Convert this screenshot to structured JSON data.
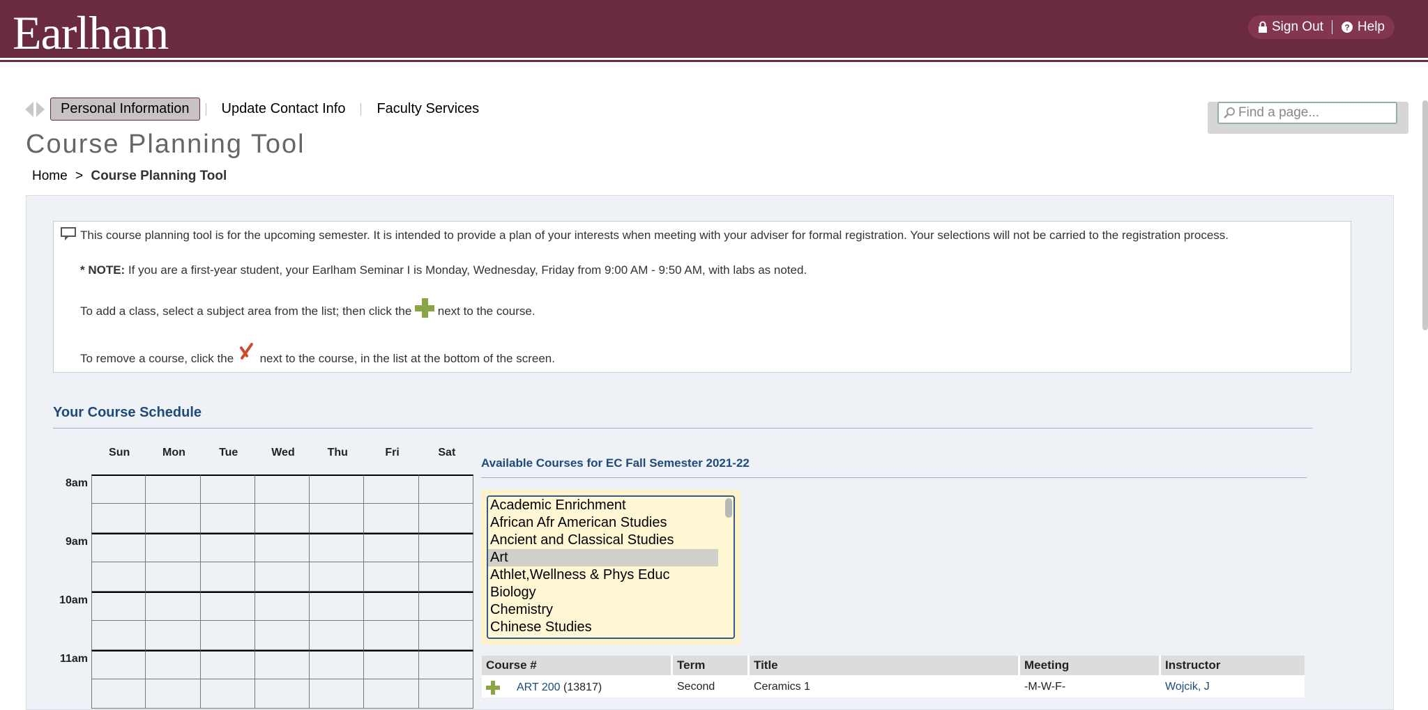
{
  "header": {
    "logo_text": "Earlham",
    "sign_out": "Sign Out",
    "help": "Help"
  },
  "nav": {
    "tabs": [
      {
        "label": "Personal Information",
        "active": true
      },
      {
        "label": "Update Contact Info",
        "active": false
      },
      {
        "label": "Faculty Services",
        "active": false
      }
    ]
  },
  "search": {
    "placeholder": "Find a page..."
  },
  "page": {
    "title": "Course Planning Tool",
    "breadcrumb_home": "Home",
    "breadcrumb_sep": ">",
    "breadcrumb_current": "Course Planning Tool"
  },
  "info": {
    "intro": "This course planning tool is for the upcoming semester. It is intended to provide a plan of your interests when meeting with your adviser for formal registration. Your selections will not be carried to the registration process.",
    "note_label": "* NOTE:",
    "note_text": " If you are a first-year student, your Earlham Seminar I is Monday, Wednesday, Friday from 9:00 AM - 9:50 AM, with labs as noted.",
    "add_before": "To add a class, select a subject area from the list; then click the ",
    "add_after": " next to the course.",
    "remove_before": "To remove a course, click the ",
    "remove_after": " next to the course, in the list at the bottom of the screen."
  },
  "schedule": {
    "title": "Your Course Schedule",
    "days": [
      "Sun",
      "Mon",
      "Tue",
      "Wed",
      "Thu",
      "Fri",
      "Sat"
    ],
    "times": [
      "8am",
      "9am",
      "10am",
      "11am"
    ]
  },
  "available": {
    "title": "Available Courses for EC Fall Semester 2021-22",
    "subjects": [
      "Academic Enrichment",
      "African Afr American Studies",
      "Ancient and Classical Studies",
      "Art",
      "Athlet,Wellness & Phys Educ",
      "Biology",
      "Chemistry",
      "Chinese Studies"
    ],
    "selected_subject": "Art"
  },
  "courses": {
    "columns": [
      "Course #",
      "Term",
      "Title",
      "Meeting",
      "Instructor"
    ],
    "rows": [
      {
        "course_link": "ART 200",
        "course_id": "(13817)",
        "term": "Second",
        "title": "Ceramics 1",
        "meeting": "-M-W-F-",
        "instructor": "Wojcik, J"
      }
    ]
  },
  "colors": {
    "brand": "#6a2a3f",
    "heading_blue": "#1e4a7a",
    "add_green": "#8aa548",
    "remove_red": "#d04a2a"
  },
  "icons": [
    "lock-icon",
    "help-icon",
    "search-icon",
    "comment-icon",
    "plus-icon",
    "remove-icon"
  ]
}
